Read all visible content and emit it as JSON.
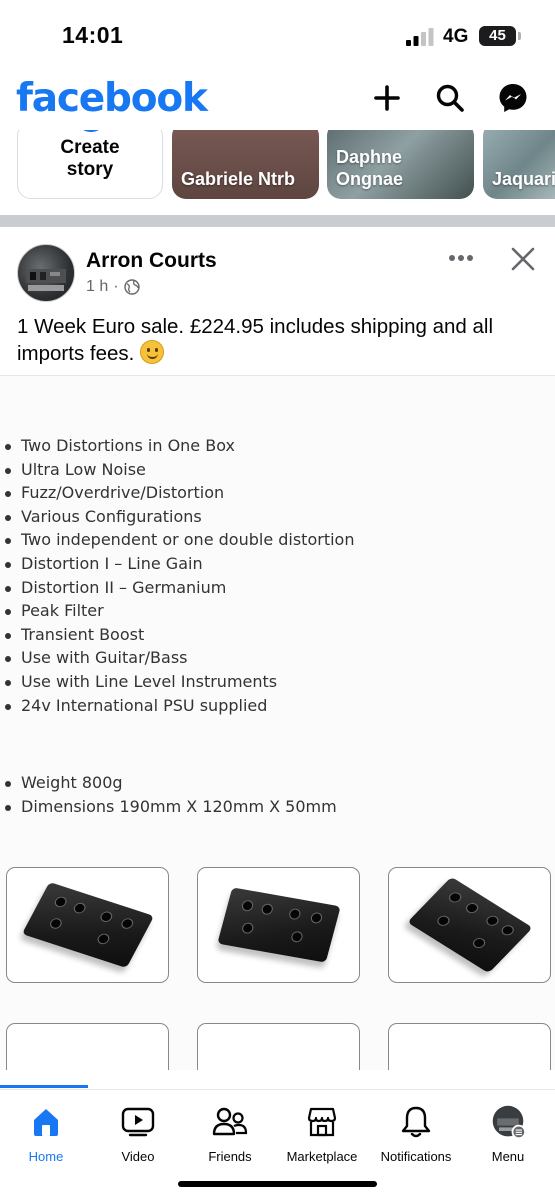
{
  "status_bar": {
    "time": "14:01",
    "network": "4G",
    "battery": "45"
  },
  "app_bar": {
    "logo": "facebook",
    "icons": [
      "plus-icon",
      "search-icon",
      "messenger-icon"
    ]
  },
  "stories": {
    "create": {
      "label": "Create story"
    },
    "items": [
      {
        "name": "Gabriele Ntrb"
      },
      {
        "name": "Daphne Ongnae"
      },
      {
        "name": "Jaquari"
      }
    ]
  },
  "post": {
    "author": "Arron Courts",
    "time": "1 h",
    "separator": "·",
    "privacy_icon": "globe-icon",
    "text": "1 Week Euro sale. £224.95 includes shipping and all imports fees.",
    "image": {
      "features": [
        "Two Distortions in One Box",
        "Ultra Low Noise",
        "Fuzz/Overdrive/Distortion",
        "Various Configurations",
        "Two independent or one double distortion",
        "Distortion I – Line Gain",
        "Distortion II – Germanium",
        "Peak Filter",
        "Transient Boost",
        "Use with Guitar/Bass",
        "Use with Line Level Instruments",
        "24v International PSU supplied"
      ],
      "specs": [
        "Weight 800g",
        "Dimensions 190mm X 120mm X 50mm"
      ]
    }
  },
  "bottom_nav": {
    "items": [
      {
        "label": "Home",
        "icon": "home-icon",
        "active": true
      },
      {
        "label": "Video",
        "icon": "video-icon"
      },
      {
        "label": "Friends",
        "icon": "friends-icon"
      },
      {
        "label": "Marketplace",
        "icon": "marketplace-icon"
      },
      {
        "label": "Notifications",
        "icon": "bell-icon"
      },
      {
        "label": "Menu",
        "icon": "menu-avatar-icon"
      }
    ]
  },
  "colors": {
    "accent": "#1877f2",
    "text": "#050505",
    "secondary_text": "#65676b",
    "divider": "#c9ccd1"
  }
}
